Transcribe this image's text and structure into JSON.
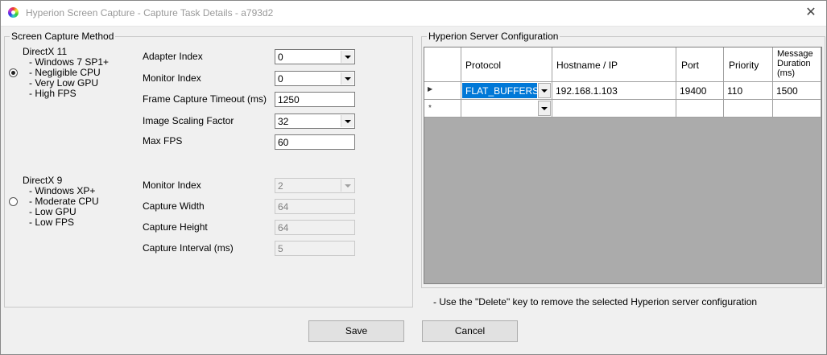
{
  "window": {
    "title": "Hyperion Screen Capture - Capture Task Details - a793d2",
    "close_glyph": "✕"
  },
  "capture_method": {
    "legend": "Screen Capture Method",
    "dx11": {
      "name": "DirectX 11",
      "features": [
        "- Windows 7 SP1+",
        "- Negligible CPU",
        "- Very Low GPU",
        "- High FPS"
      ],
      "selected": true,
      "adapter_index_label": "Adapter Index",
      "adapter_index_value": "0",
      "monitor_index_label": "Monitor Index",
      "monitor_index_value": "0",
      "frame_timeout_label": "Frame Capture Timeout (ms)",
      "frame_timeout_value": "1250",
      "scaling_label": "Image Scaling Factor",
      "scaling_value": "32",
      "max_fps_label": "Max FPS",
      "max_fps_value": "60"
    },
    "dx9": {
      "name": "DirectX 9",
      "features": [
        "- Windows XP+",
        "- Moderate CPU",
        "- Low GPU",
        "- Low FPS"
      ],
      "selected": false,
      "monitor_index_label": "Monitor Index",
      "monitor_index_value": "2",
      "width_label": "Capture Width",
      "width_value": "64",
      "height_label": "Capture Height",
      "height_value": "64",
      "interval_label": "Capture Interval (ms)",
      "interval_value": "5"
    }
  },
  "server_config": {
    "legend": "Hyperion Server Configuration",
    "columns": [
      "Protocol",
      "Hostname / IP",
      "Port",
      "Priority",
      "Message Duration (ms)"
    ],
    "rows": [
      {
        "protocol": "FLAT_BUFFERS",
        "hostname": "192.168.1.103",
        "port": "19400",
        "priority": "110",
        "duration": "1500"
      }
    ],
    "current_row_glyph": "▶",
    "new_row_glyph": "*",
    "hint": "- Use the \"Delete\" key to remove the selected Hyperion server configuration"
  },
  "buttons": {
    "save": "Save",
    "cancel": "Cancel"
  },
  "colors": {
    "selection": "#0078d7",
    "grid_background": "#ababab"
  }
}
